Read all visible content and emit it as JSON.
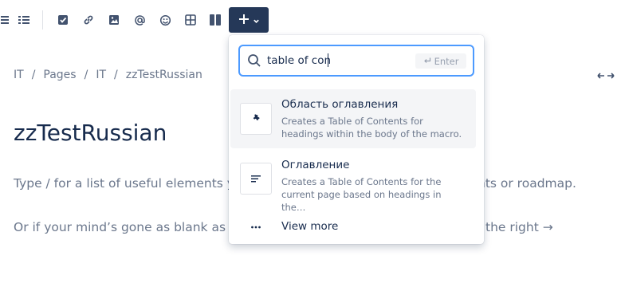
{
  "toolbar": {
    "icons": [
      "bullet-list-icon",
      "numbered-list-icon",
      "task-icon",
      "link-icon",
      "image-icon",
      "mention-icon",
      "emoji-icon",
      "table-icon",
      "layouts-icon"
    ],
    "insert_icon": "plus-icon",
    "insert_chevron": "chevron-down-icon"
  },
  "breadcrumb": [
    "IT",
    "Pages",
    "IT",
    "zzTestRussian"
  ],
  "page": {
    "title": "zzTestRussian",
    "hint_line1": "Type / for a list of useful elements yo",
    "hint_line1_right": "nts or roadmap.",
    "hint_line2": "Or if your mind’s gone as blank as th",
    "hint_line2_right": "the right →"
  },
  "popup": {
    "search_value": "table of con",
    "enter_label": "Enter",
    "items": [
      {
        "title": "Область оглавления",
        "description": "Creates a Table of Contents for headings within the body of the macro.",
        "icon": "puzzle-icon",
        "selected": true
      },
      {
        "title": "Оглавление",
        "description": "Creates a Table of Contents for the current page based on headings in the…",
        "icon": "toc-lines-icon",
        "selected": false
      }
    ],
    "view_more_label": "View more"
  },
  "colors": {
    "accent": "#253858",
    "focus_border": "#4c9aff",
    "text": "#172b4d",
    "muted": "#6b778c"
  }
}
